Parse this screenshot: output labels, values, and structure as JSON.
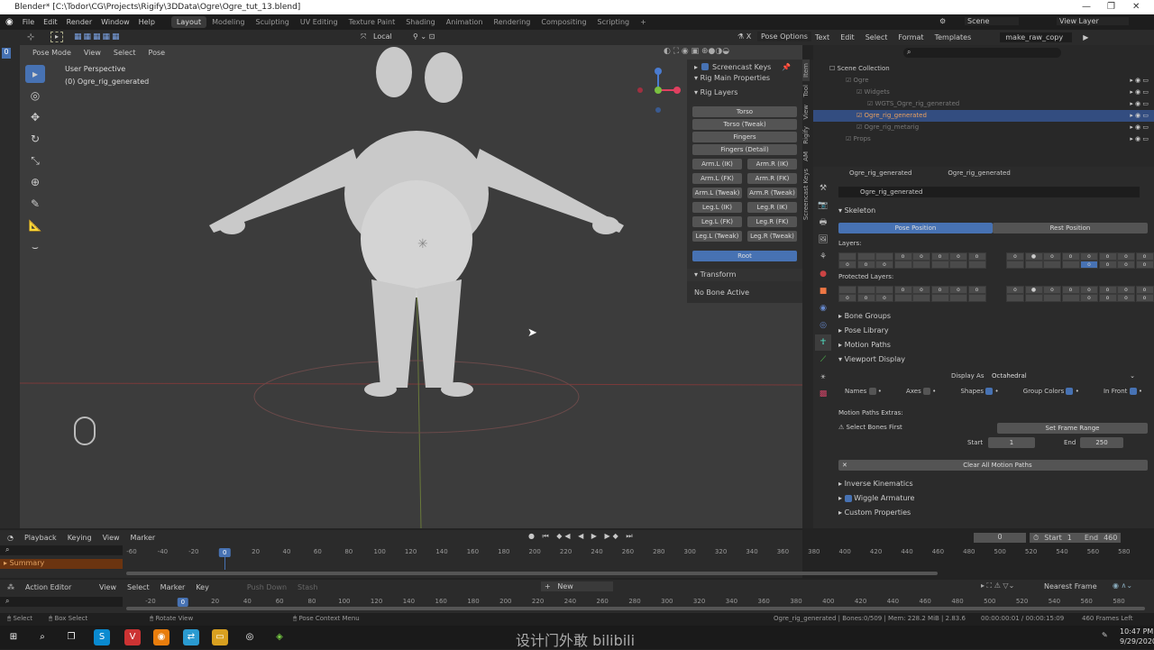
{
  "window": {
    "title": "Blender* [C:\\Todor\\CG\\Projects\\Rigify\\3DData\\Ogre\\Ogre_tut_13.blend]",
    "min": "—",
    "max": "❐",
    "close": "✕"
  },
  "menu": {
    "items": [
      "File",
      "Edit",
      "Render",
      "Window",
      "Help"
    ],
    "workspaces": [
      "Layout",
      "Modeling",
      "Sculpting",
      "UV Editing",
      "Texture Paint",
      "Shading",
      "Animation",
      "Rendering",
      "Compositing",
      "Scripting"
    ],
    "active_workspace": "Layout",
    "add": "+",
    "scene": "Scene",
    "view_layer": "View Layer"
  },
  "tool_header": {
    "orientation": "Local",
    "pose_options": "Pose Options"
  },
  "viewport": {
    "mode": "Pose Mode",
    "menus": [
      "View",
      "Select",
      "Pose"
    ],
    "perspective": "User Perspective",
    "object": "(0) Ogre_rig_generated"
  },
  "npanel": {
    "screencast_keys": "Screencast Keys",
    "rig_main_properties": "Rig Main Properties",
    "rig_layers": "Rig Layers",
    "full_buttons": [
      "Torso",
      "Torso (Tweak)",
      "Fingers",
      "Fingers (Detail)"
    ],
    "pair_buttons": [
      [
        "Arm.L (IK)",
        "Arm.R (IK)"
      ],
      [
        "Arm.L (FK)",
        "Arm.R (FK)"
      ],
      [
        "Arm.L (Tweak)",
        "Arm.R (Tweak)"
      ],
      [
        "Leg.L (IK)",
        "Leg.R (IK)"
      ],
      [
        "Leg.L (FK)",
        "Leg.R (FK)"
      ],
      [
        "Leg.L (Tweak)",
        "Leg.R (Tweak)"
      ]
    ],
    "root": "Root",
    "transform": "Transform",
    "no_bone": "No Bone Active",
    "tabs": [
      "Item",
      "Tool",
      "View",
      "Rigify",
      "AM",
      "Screencast Keys"
    ]
  },
  "text_editor": {
    "menus": [
      "Text",
      "Edit",
      "Select",
      "Format",
      "Templates"
    ],
    "file": "make_raw_copy"
  },
  "outliner": {
    "root": "Scene Collection",
    "items": [
      {
        "label": "Ogre",
        "indent": 1,
        "dim": true
      },
      {
        "label": "Widgets",
        "indent": 2,
        "dim": true
      },
      {
        "label": "WGTS_Ogre_rig_generated",
        "indent": 3,
        "dim": true
      },
      {
        "label": "Ogre_rig_generated",
        "indent": 2,
        "dim": false,
        "selected": true
      },
      {
        "label": "Ogre_rig_metarig",
        "indent": 2,
        "dim": true
      },
      {
        "label": "Props",
        "indent": 1,
        "dim": true
      }
    ]
  },
  "properties": {
    "object": "Ogre_rig_generated",
    "data": "Ogre_rig_generated",
    "armature": "Ogre_rig_generated",
    "skeleton": "Skeleton",
    "pose_position": "Pose Position",
    "rest_position": "Rest Position",
    "layers": "Layers:",
    "protected_layers": "Protected Layers:",
    "sections": [
      "Bone Groups",
      "Pose Library",
      "Motion Paths"
    ],
    "viewport_display": "Viewport Display",
    "display_as_label": "Display As",
    "display_as": "Octahedral",
    "checks": [
      {
        "label": "Names",
        "on": false
      },
      {
        "label": "Axes",
        "on": false
      },
      {
        "label": "Shapes",
        "on": true
      },
      {
        "label": "Group Colors",
        "on": true
      },
      {
        "label": "In Front",
        "on": true
      }
    ],
    "motion_paths_extras": "Motion Paths Extras:",
    "select_bones_first": "Select Bones First",
    "set_frame_range": "Set Frame Range",
    "start_label": "Start",
    "start": "1",
    "end_label": "End",
    "end": "250",
    "clear_paths": "Clear All Motion Paths",
    "bottom_sections": [
      "Inverse Kinematics",
      "Wiggle Armature",
      "Custom Properties"
    ]
  },
  "timeline": {
    "menus": [
      "Playback",
      "Keying",
      "View",
      "Marker"
    ],
    "summary": "Summary",
    "current_frame": "0",
    "start_label": "Start",
    "start": "1",
    "end_label": "End",
    "end": "460",
    "ticks": [
      "-60",
      "-40",
      "-20",
      "0",
      "20",
      "40",
      "60",
      "80",
      "100",
      "120",
      "140",
      "160",
      "180",
      "200",
      "220",
      "240",
      "260",
      "280",
      "300",
      "320",
      "340",
      "360",
      "380",
      "400",
      "420",
      "440",
      "460",
      "480",
      "500",
      "520",
      "540",
      "560",
      "580"
    ]
  },
  "action_editor": {
    "mode": "Action Editor",
    "menus": [
      "View",
      "Select",
      "Marker",
      "Key"
    ],
    "push_down": "Push Down",
    "stash": "Stash",
    "new": "New",
    "snap": "Nearest Frame",
    "ticks": [
      "-20",
      "0",
      "20",
      "40",
      "60",
      "80",
      "100",
      "120",
      "140",
      "160",
      "180",
      "200",
      "220",
      "240",
      "260",
      "280",
      "300",
      "320",
      "340",
      "360",
      "380",
      "400",
      "420",
      "440",
      "460",
      "480",
      "500",
      "520",
      "540",
      "560",
      "580"
    ]
  },
  "status": {
    "select": "Select",
    "box_select": "Box Select",
    "rotate": "Rotate View",
    "context": "Pose Context Menu",
    "info": "Ogre_rig_generated | Bones:0/509 | Mem: 228.2 MiB | 2.83.6",
    "time": "00:00:00:01 / 00:00:15:09",
    "frames_left": "460 Frames Left"
  },
  "taskbar": {
    "time": "10:47 PM",
    "date": "9/29/2020",
    "watermark": "设计门外敢 bilibili"
  },
  "colors": {
    "accent": "#4772b3",
    "summary": "#6b3410",
    "viewport": "#3c3c3c"
  }
}
